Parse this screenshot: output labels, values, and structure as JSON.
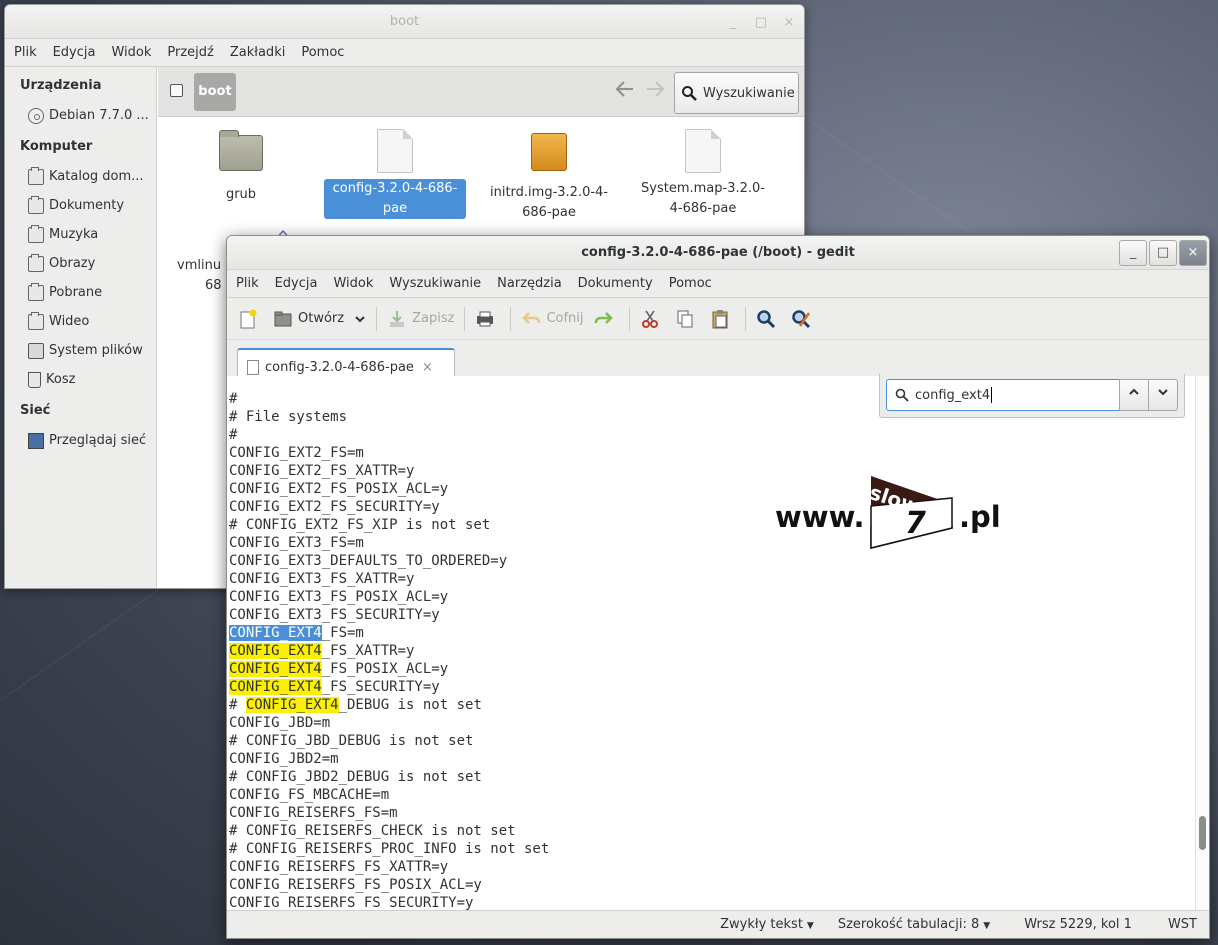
{
  "files_window": {
    "title": "boot",
    "controls": [
      "_",
      "□",
      "×"
    ],
    "menu": [
      "Plik",
      "Edycja",
      "Widok",
      "Przejdź",
      "Zakładki",
      "Pomoc"
    ],
    "sidebar": {
      "sections": [
        {
          "title": "Urządzenia",
          "items": [
            {
              "label": "Debian 7.7.0 ...",
              "icon": "disc-icon"
            }
          ]
        },
        {
          "title": "Komputer",
          "items": [
            {
              "label": "Katalog dom...",
              "icon": "home-folder-icon"
            },
            {
              "label": "Dokumenty",
              "icon": "documents-folder-icon"
            },
            {
              "label": "Muzyka",
              "icon": "music-folder-icon"
            },
            {
              "label": "Obrazy",
              "icon": "pictures-folder-icon"
            },
            {
              "label": "Pobrane",
              "icon": "downloads-folder-icon"
            },
            {
              "label": "Wideo",
              "icon": "videos-folder-icon"
            },
            {
              "label": "System plików",
              "icon": "drive-icon"
            },
            {
              "label": "Kosz",
              "icon": "trash-icon"
            }
          ]
        },
        {
          "title": "Sieć",
          "items": [
            {
              "label": "Przeglądaj sieć",
              "icon": "network-icon"
            }
          ]
        }
      ]
    },
    "pathbar": {
      "crumb": "boot",
      "back": "<",
      "forward": ">",
      "search_label": "Wyszukiwanie"
    },
    "files": [
      {
        "line1": "grub",
        "line2": "",
        "type": "folder",
        "selected": false
      },
      {
        "line1": "config-3.2.0-4-686-",
        "line2": "pae",
        "type": "text",
        "selected": true
      },
      {
        "line1": "initrd.img-3.2.0-4-",
        "line2": "686-pae",
        "type": "package",
        "selected": false
      },
      {
        "line1": "System.map-3.2.0-",
        "line2": "4-686-pae",
        "type": "text",
        "selected": false
      }
    ],
    "partial_file": {
      "line1": "vmlinu",
      "line2": "68"
    }
  },
  "gedit_window": {
    "title": "config-3.2.0-4-686-pae (/boot) - gedit",
    "controls": [
      "_",
      "□",
      "×"
    ],
    "menu": [
      "Plik",
      "Edycja",
      "Widok",
      "Wyszukiwanie",
      "Narzędzia",
      "Dokumenty",
      "Pomoc"
    ],
    "toolbar": {
      "open": "Otwórz",
      "save": "Zapisz",
      "undo": "Cofnij"
    },
    "tab": {
      "label": "config-3.2.0-4-686-pae",
      "close": "×"
    },
    "find": {
      "value": "config_ext4",
      "up": "^",
      "down": "v"
    },
    "lines": [
      [
        "#"
      ],
      [
        "# File systems"
      ],
      [
        "#"
      ],
      [
        "CONFIG_EXT2_FS=m"
      ],
      [
        "CONFIG_EXT2_FS_XATTR=y"
      ],
      [
        "CONFIG_EXT2_FS_POSIX_ACL=y"
      ],
      [
        "CONFIG_EXT2_FS_SECURITY=y"
      ],
      [
        "# CONFIG_EXT2_FS_XIP is not set"
      ],
      [
        "CONFIG_EXT3_FS=m"
      ],
      [
        "CONFIG_EXT3_DEFAULTS_TO_ORDERED=y"
      ],
      [
        "CONFIG_EXT3_FS_XATTR=y"
      ],
      [
        "CONFIG_EXT3_FS_POSIX_ACL=y"
      ],
      [
        "CONFIG_EXT3_FS_SECURITY=y"
      ],
      [
        "",
        "CONFIG_EXT4",
        "_FS=m",
        "sel"
      ],
      [
        "",
        "CONFIG_EXT4",
        "_FS_XATTR=y",
        "match"
      ],
      [
        "",
        "CONFIG_EXT4",
        "_FS_POSIX_ACL=y",
        "match"
      ],
      [
        "",
        "CONFIG_EXT4",
        "_FS_SECURITY=y",
        "match"
      ],
      [
        "# ",
        "CONFIG_EXT4",
        "_DEBUG is not set",
        "match"
      ],
      [
        "CONFIG_JBD=m"
      ],
      [
        "# CONFIG_JBD_DEBUG is not set"
      ],
      [
        "CONFIG_JBD2=m"
      ],
      [
        "# CONFIG_JBD2_DEBUG is not set"
      ],
      [
        "CONFIG_FS_MBCACHE=m"
      ],
      [
        "CONFIG_REISERFS_FS=m"
      ],
      [
        "# CONFIG_REISERFS_CHECK is not set"
      ],
      [
        "# CONFIG_REISERFS_PROC_INFO is not set"
      ],
      [
        "CONFIG_REISERFS_FS_XATTR=y"
      ],
      [
        "CONFIG_REISERFS_FS_POSIX_ACL=y"
      ],
      [
        "CONFIG_REISERFS_FS_SECURITY=y"
      ]
    ],
    "status": {
      "syntax": "Zwykły tekst",
      "tab_width": "Szerokość tabulacji:  8",
      "position": "Wrsz 5229, kol 1",
      "mode": "WST"
    }
  },
  "watermark": {
    "prefix": "www.",
    "logo_top": "slow",
    "logo_num": "7",
    "suffix": ".pl"
  },
  "colors": {
    "selection": "#4a90d9",
    "match": "#fcf000"
  }
}
